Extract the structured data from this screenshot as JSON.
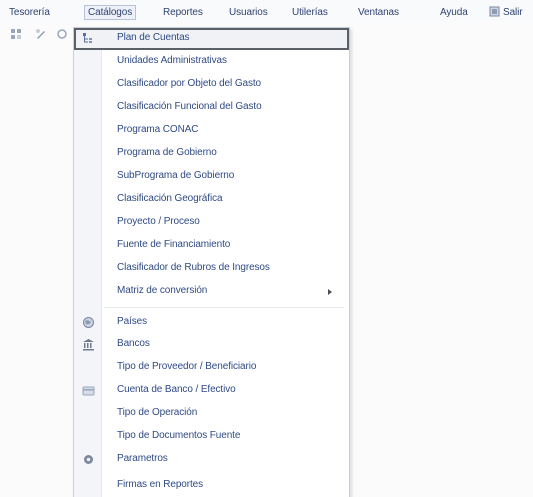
{
  "menubar": {
    "items": [
      {
        "label": "Tesorería"
      },
      {
        "label": "Catálogos"
      },
      {
        "label": "Reportes"
      },
      {
        "label": "Usuarios"
      },
      {
        "label": "Utilerías"
      },
      {
        "label": "Ventanas"
      },
      {
        "label": "Ayuda"
      },
      {
        "label": "Salir"
      }
    ]
  },
  "menu": {
    "items": [
      {
        "label": "Plan de Cuentas",
        "icon": "tree-icon",
        "highlighted": true
      },
      {
        "label": "Unidades Administrativas"
      },
      {
        "label": "Clasificador por Objeto del Gasto"
      },
      {
        "label": "Clasificación Funcional del Gasto"
      },
      {
        "label": "Programa CONAC"
      },
      {
        "label": "Programa de Gobierno"
      },
      {
        "label": "SubPrograma de Gobierno"
      },
      {
        "label": "Clasificación Geográfica"
      },
      {
        "label": "Proyecto / Proceso"
      },
      {
        "label": "Fuente de Financiamiento"
      },
      {
        "label": "Clasificador de Rubros de Ingresos"
      },
      {
        "label": "Matriz de conversión",
        "submenu": true
      },
      {
        "label": "Países",
        "icon": "globe-icon"
      },
      {
        "label": "Bancos",
        "icon": "bank-icon"
      },
      {
        "label": "Tipo de Proveedor / Beneficiario"
      },
      {
        "label": "Cuenta de Banco / Efectivo",
        "icon": "card-icon"
      },
      {
        "label": "Tipo de Operación"
      },
      {
        "label": "Tipo de Documentos Fuente"
      },
      {
        "label": "Parametros",
        "icon": "gear-icon"
      },
      {
        "label": "Firmas en Reportes"
      }
    ]
  },
  "colors": {
    "menu_text": "#2f4a85",
    "highlight_border": "#5b5f66"
  }
}
